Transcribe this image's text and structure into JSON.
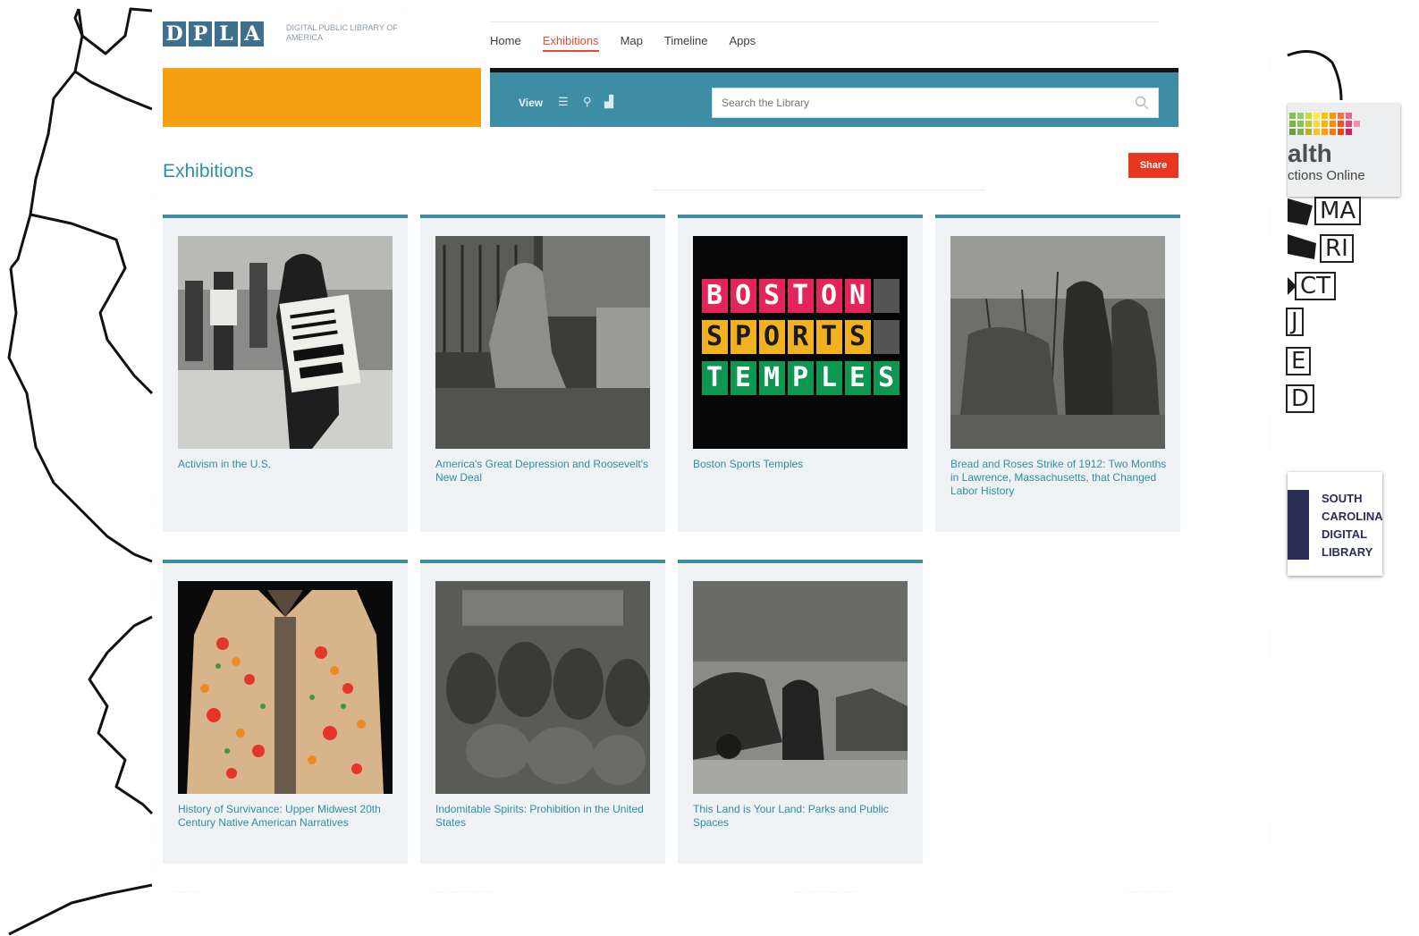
{
  "map_labels": [
    "MA",
    "RI",
    "CT",
    "J",
    "E",
    "D"
  ],
  "health_logo": {
    "word": "alth",
    "sub": "ctions Online"
  },
  "scdl_logo": {
    "lines": [
      "SOUTH",
      "CAROLINA",
      "DIGITAL",
      "LIBRARY"
    ]
  },
  "site": {
    "logo_letters": [
      "D",
      "P",
      "L",
      "A"
    ],
    "logo_subtitle": "DIGITAL PUBLIC LIBRARY OF AMERICA"
  },
  "nav": {
    "items": [
      {
        "label": "Home",
        "active": false
      },
      {
        "label": "Exhibitions",
        "active": true
      },
      {
        "label": "Map",
        "active": false
      },
      {
        "label": "Timeline",
        "active": false
      },
      {
        "label": "Apps",
        "active": false
      }
    ]
  },
  "search_bar": {
    "view_label": "View",
    "placeholder": "Search the Library"
  },
  "page": {
    "title": "Exhibitions",
    "share_label": "Share"
  },
  "boston_tiles": {
    "rows": [
      {
        "letters": [
          "B",
          "O",
          "S",
          "T",
          "O",
          "N"
        ],
        "color": "#e5245b"
      },
      {
        "letters": [
          "S",
          "P",
          "O",
          "R",
          "T",
          "S"
        ],
        "color": "#f2b21f"
      },
      {
        "letters": [
          "T",
          "E",
          "M",
          "P",
          "L",
          "E",
          "S"
        ],
        "color": "#0c9650"
      }
    ]
  },
  "exhibitions": [
    {
      "title": "Activism in the U.S."
    },
    {
      "title": "America's Great Depression and Roosevelt's New Deal"
    },
    {
      "title": "Boston Sports Temples"
    },
    {
      "title": "Bread and Roses Strike of 1912: Two Months in Lawrence, Massachusetts, that Changed Labor History"
    },
    {
      "title": "History of Survivance: Upper Midwest 20th Century Native American Narratives"
    },
    {
      "title": "Indomitable Spirits: Prohibition in the United States"
    },
    {
      "title": "This Land is Your Land: Parks and Public Spaces"
    }
  ],
  "colors": {
    "teal": "#3d8ea4",
    "orange": "#f6a011",
    "accent_red": "#e84a3a",
    "share_red": "#e8371f"
  }
}
